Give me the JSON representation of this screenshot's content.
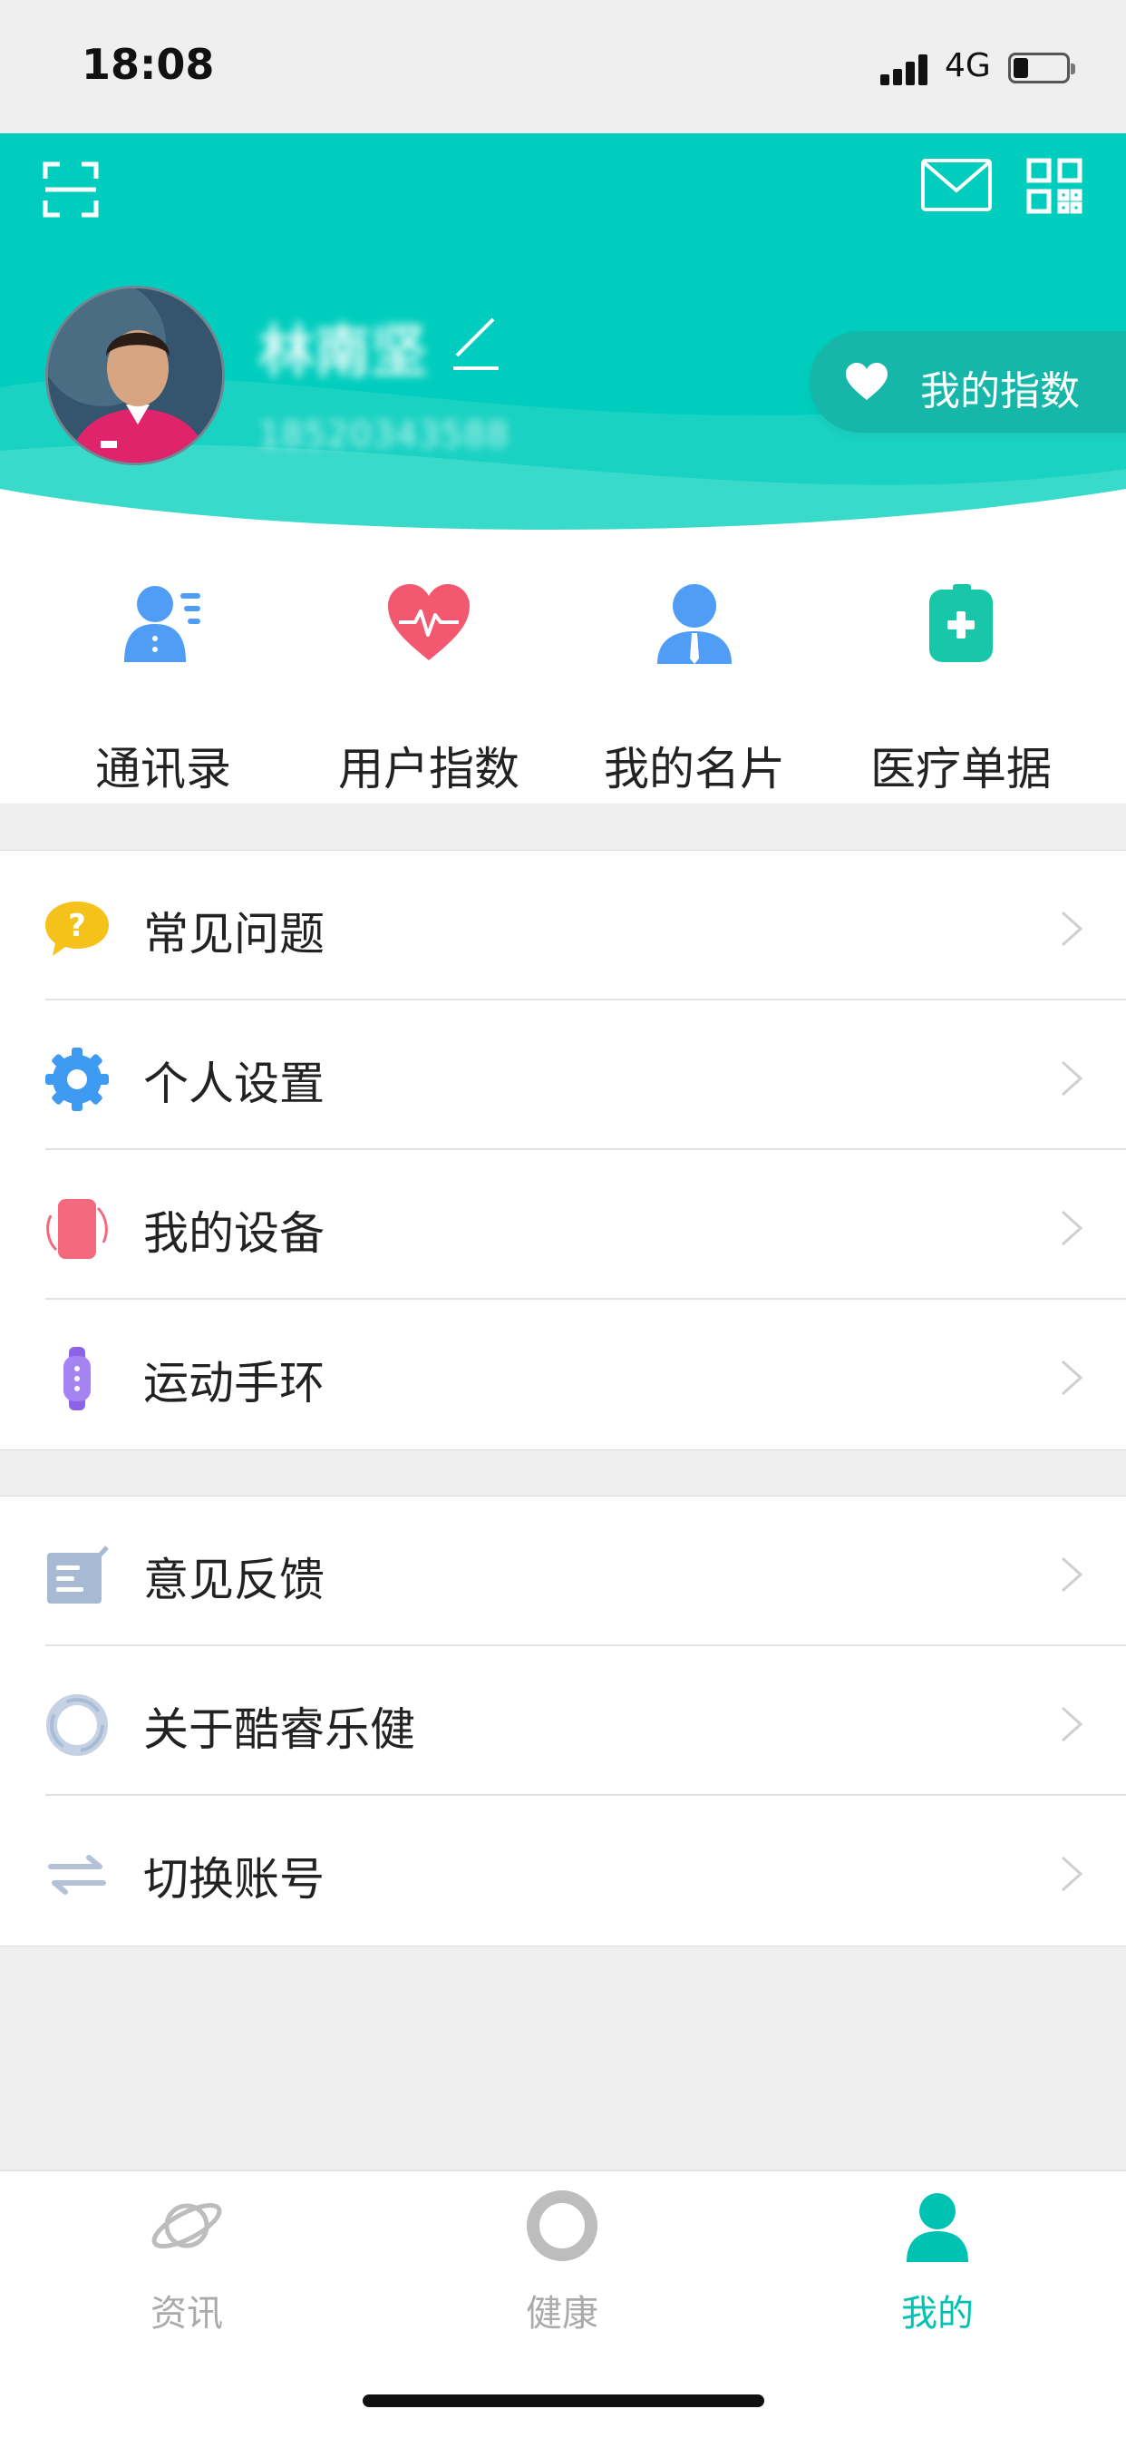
{
  "status_bar": {
    "time": "18:08",
    "network": "4G"
  },
  "header": {
    "user_name": "林南坚",
    "user_phone": "18520343588",
    "index_button_label": "我的指数"
  },
  "shortcuts": [
    {
      "label": "通讯录",
      "icon": "contacts-icon"
    },
    {
      "label": "用户指数",
      "icon": "heart-pulse-icon"
    },
    {
      "label": "我的名片",
      "icon": "user-card-icon"
    },
    {
      "label": "医疗单据",
      "icon": "medical-records-icon"
    }
  ],
  "menu_group_1": [
    {
      "label": "常见问题",
      "icon": "faq-icon"
    },
    {
      "label": "个人设置",
      "icon": "gear-icon"
    },
    {
      "label": "我的设备",
      "icon": "phone-device-icon"
    },
    {
      "label": "运动手环",
      "icon": "band-icon"
    }
  ],
  "menu_group_2": [
    {
      "label": "意见反馈",
      "icon": "feedback-icon"
    },
    {
      "label": "关于酷睿乐健",
      "icon": "about-icon"
    },
    {
      "label": "切换账号",
      "icon": "switch-account-icon"
    }
  ],
  "tabbar": [
    {
      "label": "资讯",
      "icon": "planet-icon",
      "active": false
    },
    {
      "label": "健康",
      "icon": "ring-icon",
      "active": false
    },
    {
      "label": "我的",
      "icon": "person-icon",
      "active": true
    }
  ],
  "colors": {
    "accent": "#00cdbd",
    "accent_dark": "#16b7a9",
    "tab_active": "#00c2b3",
    "tab_inactive": "#aaaaaa"
  }
}
